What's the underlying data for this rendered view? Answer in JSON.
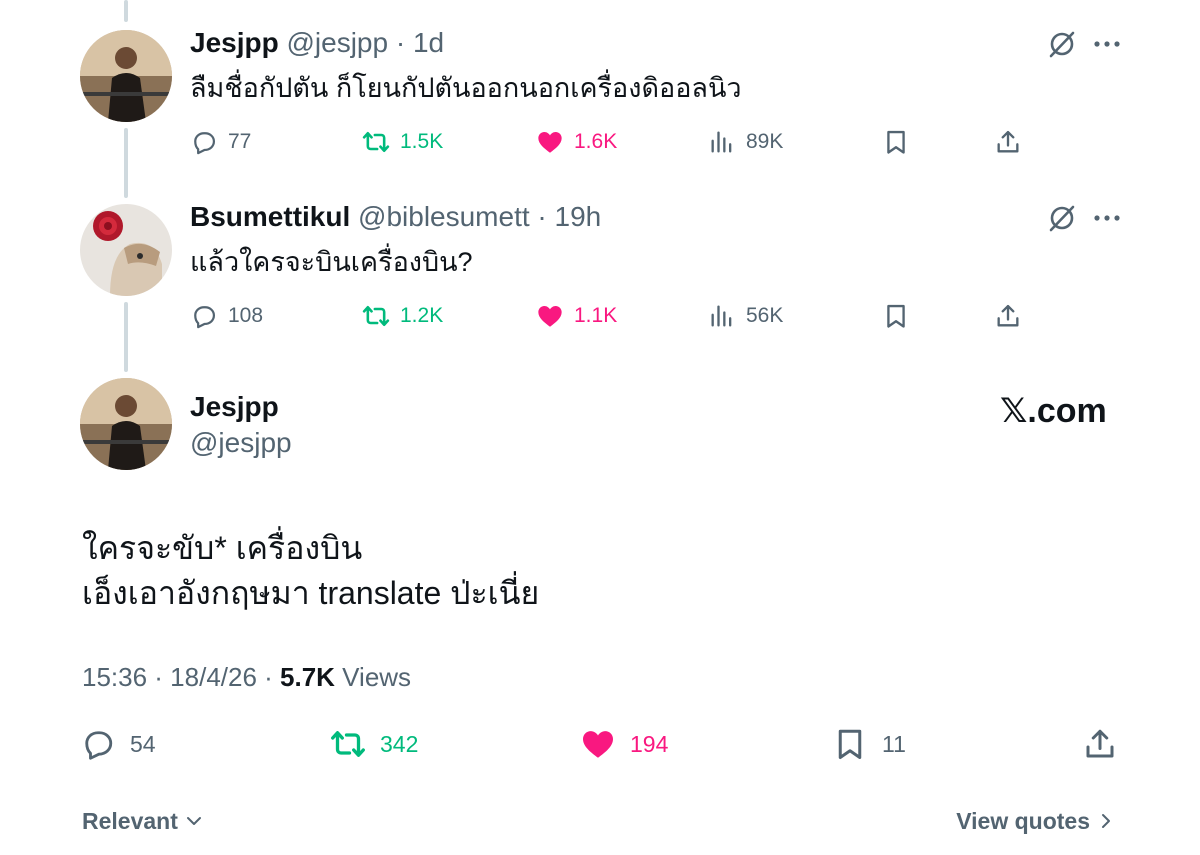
{
  "tweets": [
    {
      "name": "Jesjpp",
      "handle": "@jesjpp",
      "separator": "·",
      "time": "1d",
      "text": "ลืมชื่อกัปตัน ก็โยนกัปตันออกนอกเครื่องดิออลนิว",
      "replies": "77",
      "reposts": "1.5K",
      "likes": "1.6K",
      "views": "89K"
    },
    {
      "name": "Bsumettikul",
      "handle": "@biblesumett",
      "separator": "·",
      "time": "19h",
      "text": "แล้วใครจะบินเครื่องบิน?",
      "replies": "108",
      "reposts": "1.2K",
      "likes": "1.1K",
      "views": "56K"
    }
  ],
  "main": {
    "name": "Jesjpp",
    "handle": "@jesjpp",
    "brand": "𝕏.com",
    "text_line1": "ใครจะขับ* เครื่องบิน",
    "text_line2": "เอ็งเอาอังกฤษมา translate ป่ะเนี่ย",
    "timestamp": "15:36 · 18/4/26 · ",
    "views_count": "5.7K",
    "views_label": " Views",
    "replies": "54",
    "reposts": "342",
    "likes": "194",
    "bookmarks": "11"
  },
  "footer": {
    "sort_label": "Relevant",
    "quotes_label": "View quotes"
  },
  "colors": {
    "text": "#0f1419",
    "secondary": "#536471",
    "repost": "#00ba7c",
    "like": "#f91880",
    "thread_line": "#cfd9de"
  },
  "icons": [
    "reply-icon",
    "repost-icon",
    "heart-icon",
    "views-icon",
    "bookmark-icon",
    "share-icon",
    "grok-icon",
    "more-icon",
    "chevron-down-icon",
    "chevron-right-icon"
  ]
}
